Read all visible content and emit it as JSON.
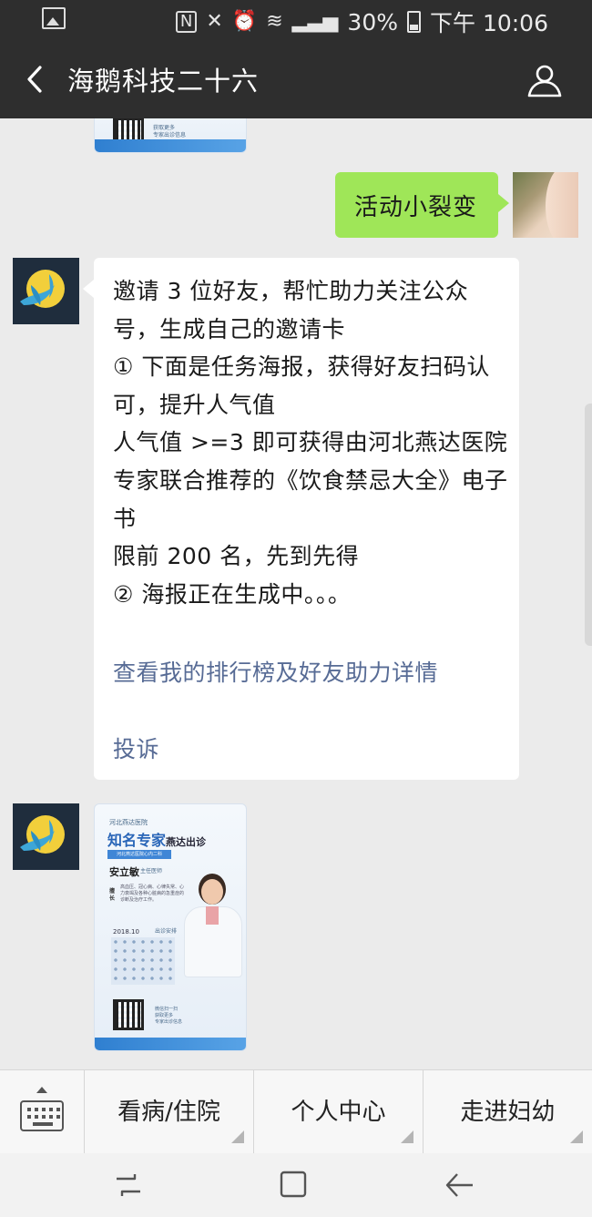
{
  "status_bar": {
    "signal_text": "N",
    "battery": "30%",
    "time": "下午 10:06"
  },
  "header": {
    "title": "海鹅科技二十六",
    "back_icon": "chevron-left-icon",
    "profile_icon": "user-icon"
  },
  "messages": {
    "outgoing_text": "活动小裂变",
    "invite_text": "邀请 3 位好友，帮忙助力关注公众号，生成自己的邀请卡\n① 下面是任务海报，获得好友扫码认可，提升人气值\n人气值 >=3 即可获得由河北燕达医院专家联合推荐的《饮食禁忌大全》电子书\n限前 200 名，先到先得\n② 海报正在生成中。。。",
    "ranking_link": "查看我的排行榜及好友助力详情",
    "complaint_link": "投诉"
  },
  "poster": {
    "hospital": "河北燕达医院",
    "headline_a": "知名专家",
    "headline_b": "燕达出诊",
    "subline": "河北燕达医院心内二科",
    "doctor_name": "安立敏",
    "doctor_title": "主任医师",
    "specialty_label": "擅长",
    "specialty_text": "高血压、冠心病、心律失常、心力衰竭及各种心脏病的急重症的诊断及治疗工作。",
    "calendar_label": "2018.10",
    "clinic_label": "出诊安排",
    "qr_caption": "微信扫一扫",
    "qr_caption_2": "获取更多",
    "qr_caption_3": "专家出诊信息",
    "top_caption_1": "获取更多",
    "top_caption_2": "专家出诊信息"
  },
  "bottom_menu": {
    "item1": "看病/住院",
    "item2": "个人中心",
    "item3": "走进妇幼"
  },
  "colors": {
    "header_bg": "#2e2e2e",
    "chat_bg": "#ebebeb",
    "outgoing_bubble": "#9fe658",
    "link": "#576b95"
  }
}
